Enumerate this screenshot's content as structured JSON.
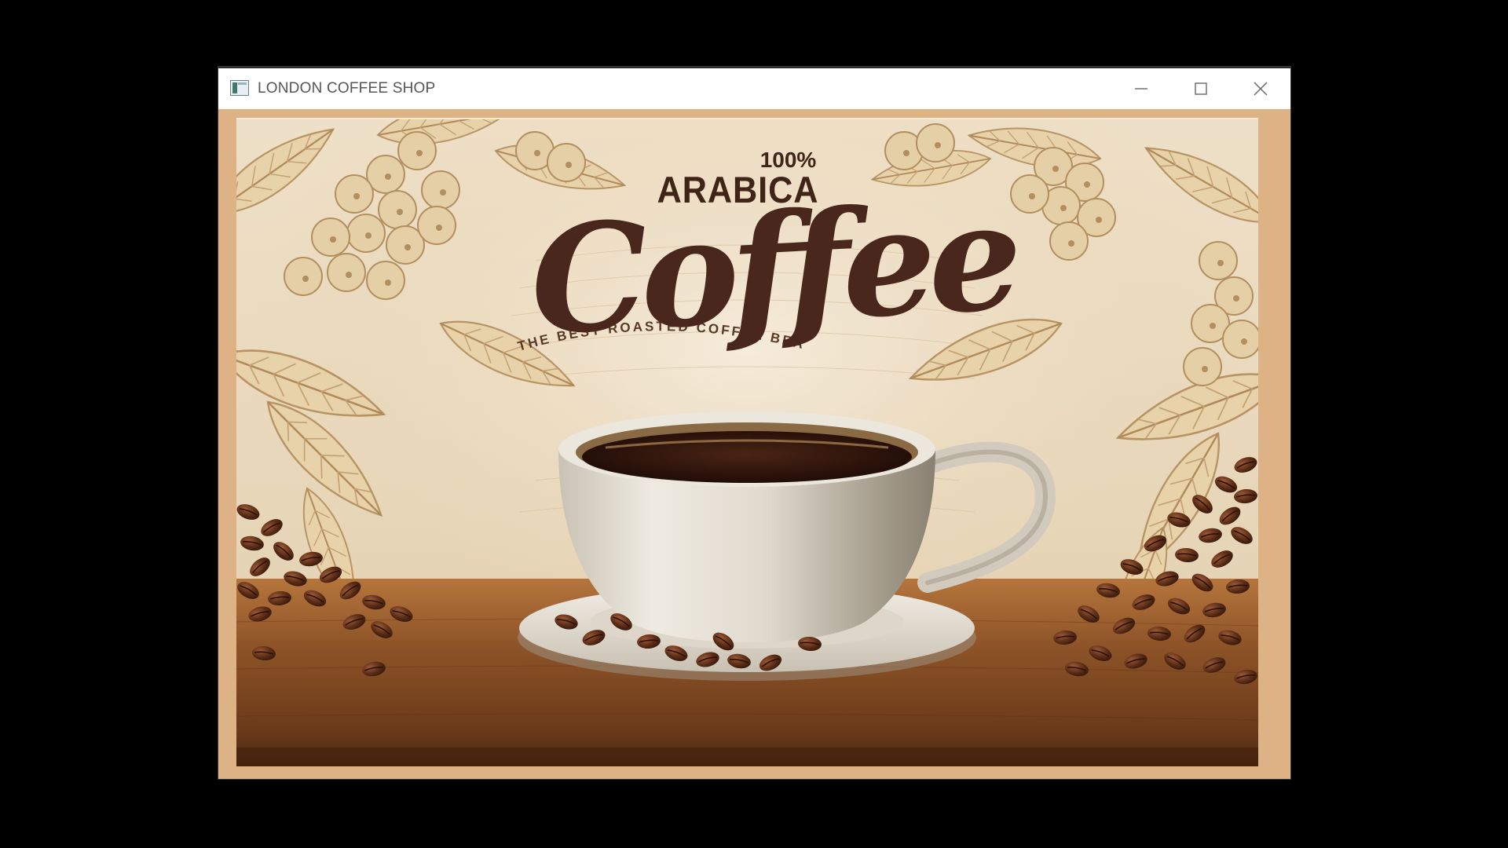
{
  "window": {
    "title": "LONDON COFFEE SHOP",
    "app_icon": "app-window-icon",
    "controls": {
      "minimize_icon": "minimize-icon",
      "maximize_icon": "maximize-icon",
      "close_icon": "close-icon"
    }
  },
  "poster": {
    "percent": "100%",
    "arabica": "ARABICA",
    "coffee": "Coffee",
    "tagline": "THE BEST ROASTED COFFEE BEANS"
  },
  "colors": {
    "frame": "#ddb386",
    "title_text": "#555555",
    "lettering": "#4a271c"
  }
}
